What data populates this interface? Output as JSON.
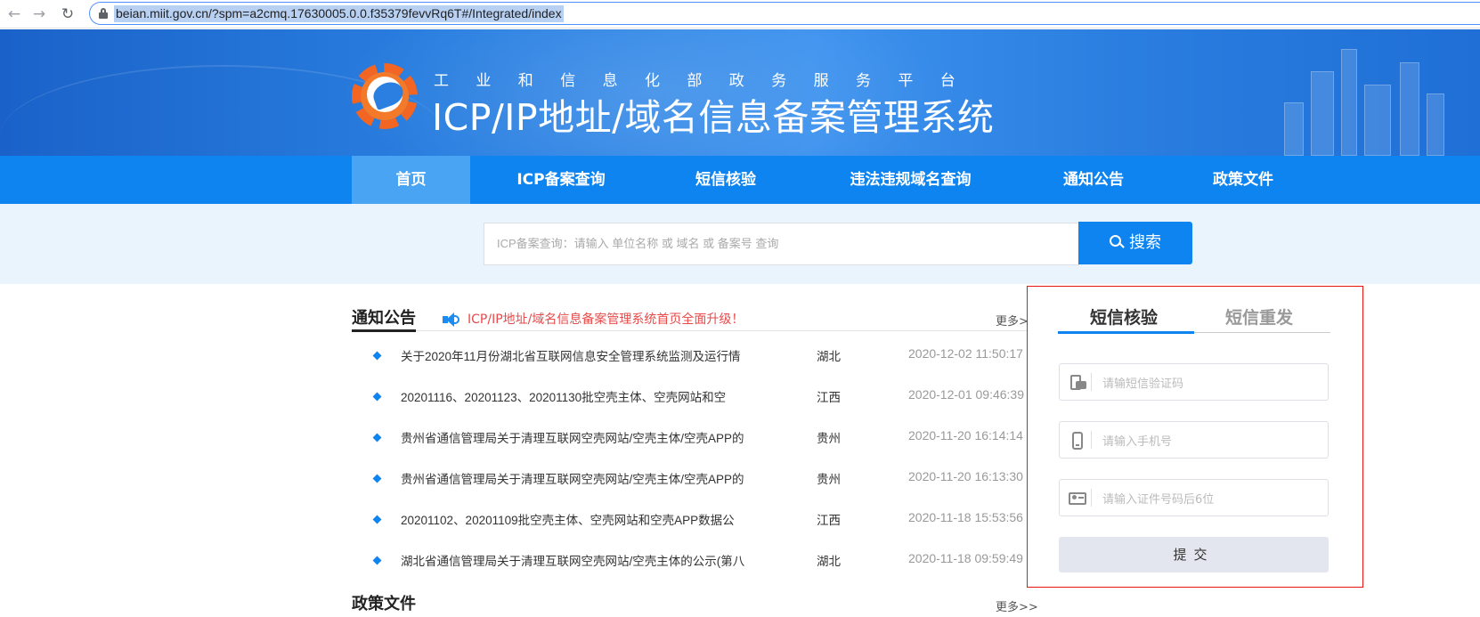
{
  "browser": {
    "url": "beian.miit.gov.cn/?spm=a2cmq.17630005.0.0.f35379fevvRq6T#/Integrated/index"
  },
  "header": {
    "subtitle": "工业和信息化部政务服务平台",
    "title": "ICP/IP地址/域名信息备案管理系统"
  },
  "nav": {
    "items": [
      "首页",
      "ICP备案查询",
      "短信核验",
      "违法违规域名查询",
      "通知公告",
      "政策文件"
    ],
    "active": "首页"
  },
  "search": {
    "placeholder": "ICP备案查询：请输入 单位名称 或 域名 或 备案号 查询",
    "button": "搜索"
  },
  "notice": {
    "title": "通知公告",
    "marquee": "ICP/IP地址/域名信息备案管理系统首页全面升级！",
    "more": "更多>>",
    "items": [
      {
        "title": "关于2020年11月份湖北省互联网信息安全管理系统监测及运行情",
        "province": "湖北",
        "time": "2020-12-02 11:50:17"
      },
      {
        "title": "20201116、20201123、20201130批空壳主体、空壳网站和空",
        "province": "江西",
        "time": "2020-12-01 09:46:39"
      },
      {
        "title": "贵州省通信管理局关于清理互联网空壳网站/空壳主体/空壳APP的",
        "province": "贵州",
        "time": "2020-11-20 16:14:14"
      },
      {
        "title": "贵州省通信管理局关于清理互联网空壳网站/空壳主体/空壳APP的",
        "province": "贵州",
        "time": "2020-11-20 16:13:30"
      },
      {
        "title": "20201102、20201109批空壳主体、空壳网站和空壳APP数据公",
        "province": "江西",
        "time": "2020-11-18 15:53:56"
      },
      {
        "title": "湖北省通信管理局关于清理互联网空壳网站/空壳主体的公示(第八",
        "province": "湖北",
        "time": "2020-11-18 09:59:49"
      }
    ]
  },
  "policy": {
    "title": "政策文件",
    "more": "更多>>"
  },
  "sms": {
    "tabs": [
      "短信核验",
      "短信重发"
    ],
    "active_tab": "短信核验",
    "fields": [
      {
        "placeholder": "请输短信验证码",
        "icon": "sms-code-icon"
      },
      {
        "placeholder": "请输入手机号",
        "icon": "mobile-phone-icon"
      },
      {
        "placeholder": "请输入证件号码后6位",
        "icon": "id-card-icon"
      }
    ],
    "submit": "提交"
  },
  "colors": {
    "nav_blue": "#0e84f0",
    "nav_active": "#4aa4f4",
    "panel_border": "#e5170f",
    "marquee_red": "#e84a4a"
  }
}
